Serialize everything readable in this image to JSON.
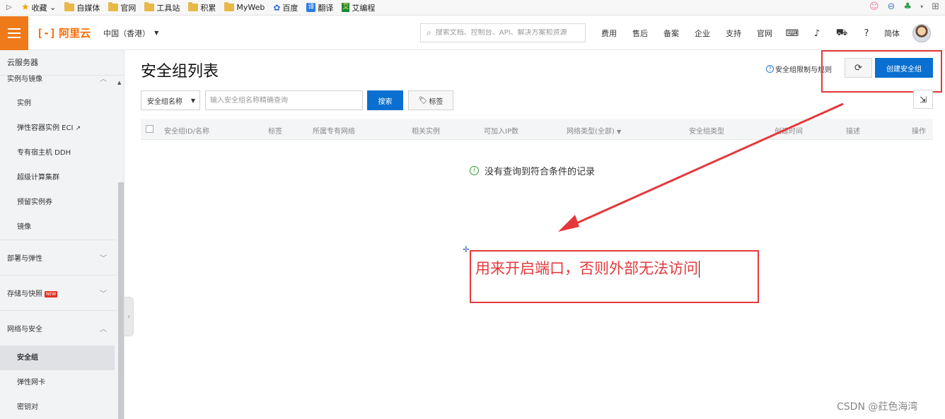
{
  "bookmarks": {
    "items": [
      "收藏",
      "自媒体",
      "官网",
      "工具站",
      "积累",
      "MyWeb",
      "百度",
      "翻译",
      "艾编程"
    ],
    "translate_badge": "译",
    "aibiancheng_badge": "艾"
  },
  "topnav": {
    "logo_mark": "[-]",
    "logo_text": "阿里云",
    "region": "中国（香港）",
    "search_placeholder": "搜索文档、控制台、API、解决方案和资源",
    "links": [
      "费用",
      "售后",
      "备案",
      "企业",
      "支持",
      "官网"
    ],
    "language": "简体"
  },
  "sidebar": {
    "title": "云服务器",
    "group_instances": "实例与镜像",
    "items": [
      "实例",
      "弹性容器实例 ECI",
      "专有宿主机 DDH",
      "超级计算集群",
      "预留实例券",
      "镜像"
    ],
    "section_deploy": "部署与弹性",
    "section_storage": "存储与快照",
    "new_badge": "NEW",
    "section_network": "网络与安全",
    "network_items": [
      "安全组",
      "弹性网卡",
      "密钥对"
    ]
  },
  "main": {
    "title": "安全组列表",
    "rules_link": "安全组限制与规则",
    "create_button": "创建安全组",
    "filter_select": "安全组名称",
    "filter_placeholder": "输入安全组名称精确查询",
    "search_button": "搜索",
    "tag_button": "标签",
    "columns": [
      "安全组ID/名称",
      "标签",
      "所属专有网络",
      "相关实例",
      "可加入IP数",
      "网络类型(全部)",
      "安全组类型",
      "创建时间",
      "描述",
      "操作"
    ],
    "empty_message": "没有查询到符合条件的记录"
  },
  "annotation": {
    "text": "用来开启端口，否则外部无法访问",
    "color": "#e4393c"
  },
  "watermark": "CSDN @荭色海湾",
  "colors": {
    "primary_blue": "#0a6fd0",
    "brand_orange": "#ef7a1a",
    "annotation_red": "#e4393c"
  }
}
